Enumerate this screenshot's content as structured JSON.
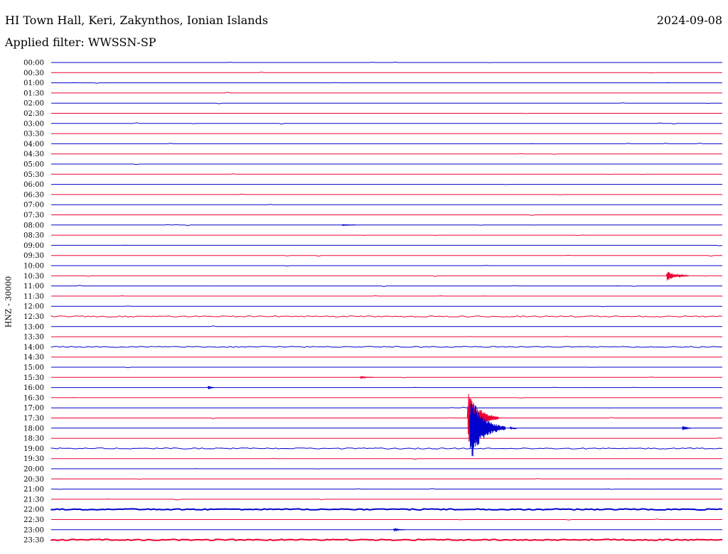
{
  "header": {
    "station": "HI Town Hall, Keri, Zakynthos, Ionian Islands",
    "date": "2024-09-08",
    "filter": "Applied filter: WWSSN-SP"
  },
  "colors": {
    "even_trace": "#0000cc",
    "odd_trace": "#ee0033"
  },
  "chart_data": {
    "type": "line",
    "title": "HI Town Hall, Keri, Zakynthos, Ionian Islands",
    "ylabel": "HNZ - 30000",
    "xlabel": "",
    "grid": false,
    "row_labels": [
      "00:00",
      "00:30",
      "01:00",
      "01:30",
      "02:00",
      "02:30",
      "03:00",
      "03:30",
      "04:00",
      "04:30",
      "05:00",
      "05:30",
      "06:00",
      "06:30",
      "07:00",
      "07:30",
      "08:00",
      "08:30",
      "09:00",
      "09:30",
      "10:00",
      "10:30",
      "11:00",
      "11:30",
      "12:00",
      "12:30",
      "13:00",
      "13:30",
      "14:00",
      "14:30",
      "15:00",
      "15:30",
      "16:00",
      "16:30",
      "17:00",
      "17:30",
      "18:00",
      "18:30",
      "19:00",
      "19:30",
      "20:00",
      "20:30",
      "21:00",
      "21:30",
      "22:00",
      "22:30",
      "23:00",
      "23:30"
    ],
    "row_duration_minutes": 30,
    "events": [
      {
        "row": "10:30",
        "minute": 27.5,
        "amplitude": 0.7,
        "duration": 1.0
      },
      {
        "row": "17:30",
        "minute": 18.6,
        "amplitude": 3.5,
        "duration": 1.4
      },
      {
        "row": "18:00",
        "minute": 18.7,
        "amplitude": 4.5,
        "duration": 1.6
      },
      {
        "row": "18:00",
        "minute": 20.5,
        "amplitude": 0.2,
        "duration": 0.3
      },
      {
        "row": "18:00",
        "minute": 28.2,
        "amplitude": 0.4,
        "duration": 0.4
      },
      {
        "row": "16:00",
        "minute": 7.0,
        "amplitude": 0.3,
        "duration": 0.3
      },
      {
        "row": "23:00",
        "minute": 15.3,
        "amplitude": 0.2,
        "duration": 0.5
      },
      {
        "row": "15:30",
        "minute": 13.8,
        "amplitude": 0.15,
        "duration": 0.6
      },
      {
        "row": "08:00",
        "minute": 13.0,
        "amplitude": 0.1,
        "duration": 0.6
      }
    ],
    "noisy_rows": [
      "12:30",
      "14:00",
      "19:00",
      "22:00",
      "23:30"
    ]
  }
}
